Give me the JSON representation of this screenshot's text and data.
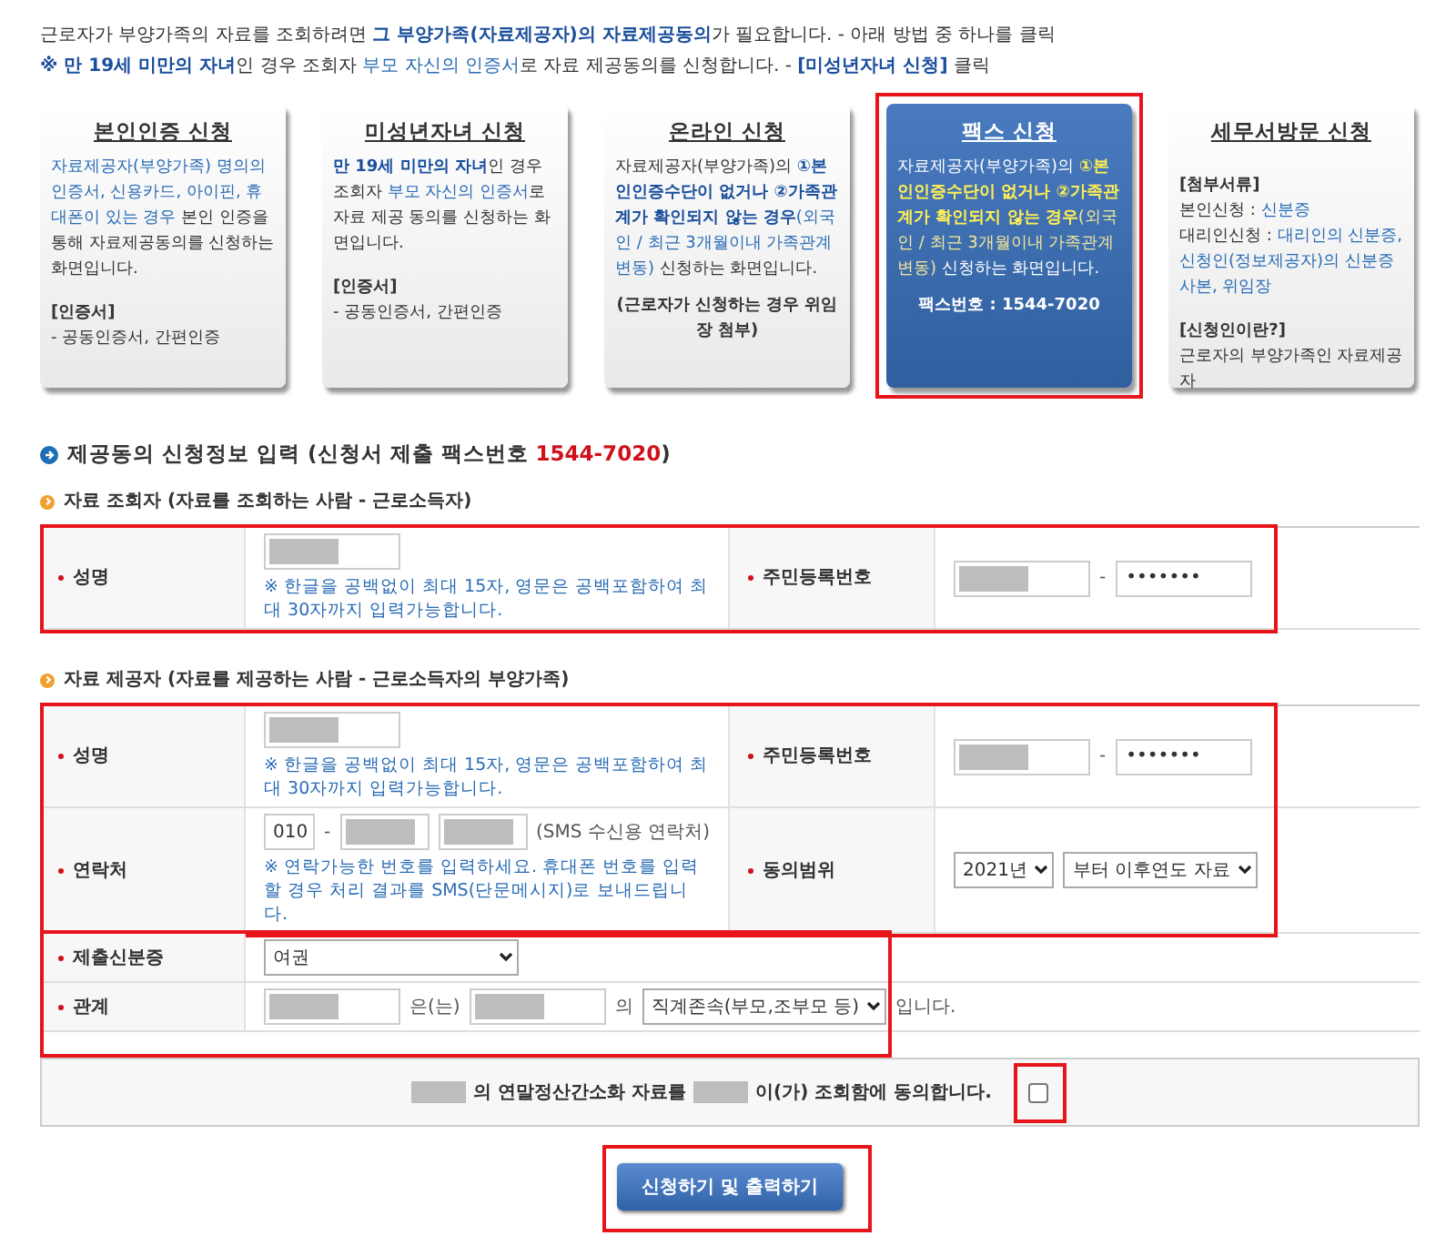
{
  "intro": [
    [
      {
        "text": "근로자가 부양가족의 자료를 조회하려면 ",
        "color": "#333333"
      },
      {
        "text": "**그 부양가족(자료제공자)의 자료제공동의**",
        "color": "#1a4f9c"
      },
      {
        "text": "가 필요합니다. - 아래 방법 중 하나를 클릭",
        "color": "#333333"
      }
    ],
    [
      {
        "text": "**※ 만 19세 미만의 자녀**",
        "color": "#1a4f9c"
      },
      {
        "text": "인 경우 조회자 ",
        "color": "#333333"
      },
      {
        "text": "부모 자신의 인증서",
        "color": "#2a6cb5"
      },
      {
        "text": "로 자료 제공동의를 신청합니다. - ",
        "color": "#333333"
      },
      {
        "text": "**[미성년자녀 신청]**",
        "color": "#1a4f9c"
      },
      {
        "text": " 클릭",
        "color": "#333333"
      }
    ]
  ],
  "cards": [
    {
      "title": "본인인증 신청",
      "selected": false,
      "highlighted": false,
      "blocks": [
        {
          "kind": "para",
          "segments": [
            {
              "text": "자료제공자(부양가족) 명의의 인증서, 신용카드, 아이핀,  휴대폰이 있는 경우",
              "color": "#2a6cb5"
            },
            {
              "text": " 본인 인증을 통해 자료제공동의를 신청하는 화면입니다.",
              "color": "#333333"
            }
          ]
        },
        {
          "kind": "heading",
          "segments": [
            {
              "text": "[인증서]",
              "color": "#333333"
            }
          ]
        },
        {
          "kind": "para",
          "segments": [
            {
              "text": "- 공동인증서, 간편인증",
              "color": "#333333"
            }
          ]
        }
      ]
    },
    {
      "title": "미성년자녀 신청",
      "selected": false,
      "highlighted": false,
      "blocks": [
        {
          "kind": "para",
          "segments": [
            {
              "text": "**만 19세 미만의 자녀**",
              "color": "#1a4f9c"
            },
            {
              "text": "인 경우 조회자 ",
              "color": "#333333"
            },
            {
              "text": "부모 자신의 인증서",
              "color": "#2a6cb5"
            },
            {
              "text": "로 자료 제공 동의를 신청하는 화면입니다.",
              "color": "#333333"
            }
          ]
        },
        {
          "kind": "heading",
          "segments": [
            {
              "text": "[인증서]",
              "color": "#333333"
            }
          ]
        },
        {
          "kind": "para",
          "segments": [
            {
              "text": "- 공동인증서, 간편인증",
              "color": "#333333"
            }
          ]
        }
      ]
    },
    {
      "title": "온라인 신청",
      "selected": false,
      "highlighted": false,
      "blocks": [
        {
          "kind": "para",
          "segments": [
            {
              "text": "자료제공자(부양가족)의 ",
              "color": "#333333"
            },
            {
              "text": "**①본인인증수단이 없거나 ②가족관계가 확인되지 않는 경우**",
              "color": "#1a4f9c"
            },
            {
              "text": "(외국인 / 최근 3개월이내 가족관계 변동)",
              "color": "#2a6cb5"
            },
            {
              "text": " 신청하는 화면입니다.",
              "color": "#333333"
            }
          ]
        },
        {
          "kind": "note",
          "segments": [
            {
              "text": "(근로자가 신청하는 경우 위임장 첨부)",
              "color": "#333333"
            }
          ]
        }
      ]
    },
    {
      "title": "팩스 신청",
      "selected": true,
      "highlighted": true,
      "blocks": [
        {
          "kind": "para",
          "segments": [
            {
              "text": "자료제공자(부양가족)의 ",
              "color": "#ffffff"
            },
            {
              "text": "**①본인인증수단이 없거나 ②가족관계가 확인되지 않는 경우**",
              "color": "#ffee55"
            },
            {
              "text": "(외국인 / 최근 3개월이내 가족관계 변동)",
              "color": "#f2e79a"
            },
            {
              "text": " 신청하는 화면입니다.",
              "color": "#ffffff"
            }
          ]
        },
        {
          "kind": "note",
          "segments": [
            {
              "text": "팩스번호 : 1544-7020",
              "color": "#ffffff"
            }
          ]
        }
      ]
    },
    {
      "title": "세무서방문 신청",
      "selected": false,
      "highlighted": false,
      "blocks": [
        {
          "kind": "heading",
          "segments": [
            {
              "text": "[첨부서류]",
              "color": "#333333"
            }
          ]
        },
        {
          "kind": "para",
          "segments": [
            {
              "text": "본인신청 : ",
              "color": "#333333"
            },
            {
              "text": "신분증",
              "color": "#2a6cb5"
            }
          ]
        },
        {
          "kind": "para",
          "segments": [
            {
              "text": "대리인신청 : ",
              "color": "#333333"
            },
            {
              "text": "대리인의 신분증, 신청인(정보제공자)의 신분증 사본, 위임장",
              "color": "#2a6cb5"
            }
          ]
        },
        {
          "kind": "heading",
          "segments": [
            {
              "text": "[신청인이란?]",
              "color": "#333333"
            }
          ]
        },
        {
          "kind": "para",
          "segments": [
            {
              "text": "근로자의 부양가족인 자료제공자",
              "color": "#333333"
            }
          ]
        }
      ]
    }
  ],
  "section_title": [
    {
      "text": "제공동의 신청정보 입력 (신청서 제출 팩스번호 ",
      "color": "#333333"
    },
    {
      "text": "1544-7020",
      "color": "#d0111b"
    },
    {
      "text": ")",
      "color": "#333333"
    }
  ],
  "groups": [
    {
      "title": "자료 조회자 (자료를 조회하는 사람 - 근로소득자)",
      "row_groups": [
        {
          "highlighted": true,
          "rows": [
            {
              "cells": [
                {
                  "label": "성명",
                  "required": true,
                  "lines": [
                    [
                      {
                        "kind": "redacted-input"
                      }
                    ],
                    [
                      {
                        "kind": "note",
                        "text": "※ 한글을 공백없이 최대 15자, 영문은 공백포함하여 최대 30자까지 입력가능합니다."
                      }
                    ]
                  ]
                },
                {
                  "label": "주민등록번호",
                  "required": true,
                  "lines": [
                    [
                      {
                        "kind": "redacted-input"
                      },
                      {
                        "kind": "text",
                        "text": "-"
                      },
                      {
                        "kind": "password-input",
                        "value": "•••••••"
                      }
                    ]
                  ]
                }
              ]
            }
          ]
        }
      ]
    },
    {
      "title": "자료 제공자 (자료를 제공하는 사람 - 근로소득자의 부양가족)",
      "row_groups": [
        {
          "highlighted": true,
          "rows": [
            {
              "cells": [
                {
                  "label": "성명",
                  "required": true,
                  "lines": [
                    [
                      {
                        "kind": "redacted-input"
                      }
                    ],
                    [
                      {
                        "kind": "note",
                        "text": "※ 한글을 공백없이 최대 15자, 영문은 공백포함하여 최대 30자까지 입력가능합니다."
                      }
                    ]
                  ]
                },
                {
                  "label": "주민등록번호",
                  "required": true,
                  "lines": [
                    [
                      {
                        "kind": "redacted-input"
                      },
                      {
                        "kind": "text",
                        "text": "-"
                      },
                      {
                        "kind": "password-input",
                        "value": "•••••••"
                      }
                    ]
                  ]
                }
              ]
            },
            {
              "cells": [
                {
                  "label": "연락처",
                  "required": true,
                  "lines": [
                    [
                      {
                        "kind": "short-input",
                        "value": "010"
                      },
                      {
                        "kind": "text",
                        "text": "-"
                      },
                      {
                        "kind": "redacted-input"
                      },
                      {
                        "kind": "redacted-input"
                      },
                      {
                        "kind": "text",
                        "text": "(SMS 수신용 연락처)"
                      }
                    ],
                    [
                      {
                        "kind": "note",
                        "text": "※ 연락가능한 번호를 입력하세요. 휴대폰 번호를 입력할 경우 처리 결과를 SMS(단문메시지)로 보내드립니다."
                      }
                    ]
                  ]
                },
                {
                  "label": "동의범위",
                  "required": true,
                  "lines": [
                    [
                      {
                        "kind": "select",
                        "value": "2021년"
                      },
                      {
                        "kind": "select",
                        "value": "부터 이후연도 자료"
                      }
                    ]
                  ]
                }
              ]
            }
          ]
        },
        {
          "highlighted": true,
          "rows": [
            {
              "cells": [
                {
                  "label": "제출신분증",
                  "required": true,
                  "lines": [
                    [
                      {
                        "kind": "wide-select",
                        "value": "여권"
                      }
                    ]
                  ]
                }
              ]
            },
            {
              "cells": [
                {
                  "label": "관계",
                  "required": true,
                  "lines": [
                    [
                      {
                        "kind": "redacted-input"
                      },
                      {
                        "kind": "text",
                        "text": "은(는)"
                      },
                      {
                        "kind": "redacted-input"
                      },
                      {
                        "kind": "text",
                        "text": "의"
                      },
                      {
                        "kind": "select",
                        "value": "직계존속(부모,조부모 등)"
                      },
                      {
                        "kind": "text",
                        "text": "입니다."
                      }
                    ]
                  ]
                }
              ]
            }
          ]
        }
      ]
    }
  ],
  "consent": {
    "parts": [
      {
        "kind": "redacted"
      },
      {
        "kind": "text",
        "text": "의 연말정산간소화 자료를"
      },
      {
        "kind": "redacted"
      },
      {
        "kind": "text",
        "text": "이(가) 조회함에 동의합니다."
      }
    ],
    "checked": false,
    "highlighted": true
  },
  "submit": {
    "label": "신청하기 및 출력하기",
    "highlighted": true
  }
}
